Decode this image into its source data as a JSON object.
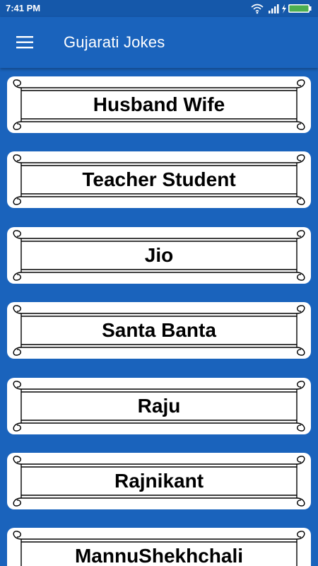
{
  "status_bar": {
    "time": "7:41 PM",
    "icons": [
      "wifi-icon",
      "signal-icon",
      "charging-icon",
      "battery-icon"
    ]
  },
  "app_bar": {
    "title": "Gujarati Jokes",
    "menu_icon": "hamburger-menu-icon"
  },
  "categories": [
    {
      "label": "Husband Wife"
    },
    {
      "label": "Teacher Student"
    },
    {
      "label": "Jio"
    },
    {
      "label": "Santa Banta"
    },
    {
      "label": "Raju"
    },
    {
      "label": "Rajnikant"
    },
    {
      "label": "MannuShekhchali"
    }
  ],
  "colors": {
    "background": "#1a63bc",
    "status_bar": "#1558aa",
    "card": "#ffffff",
    "text": "#000000",
    "battery": "#4caf50"
  }
}
